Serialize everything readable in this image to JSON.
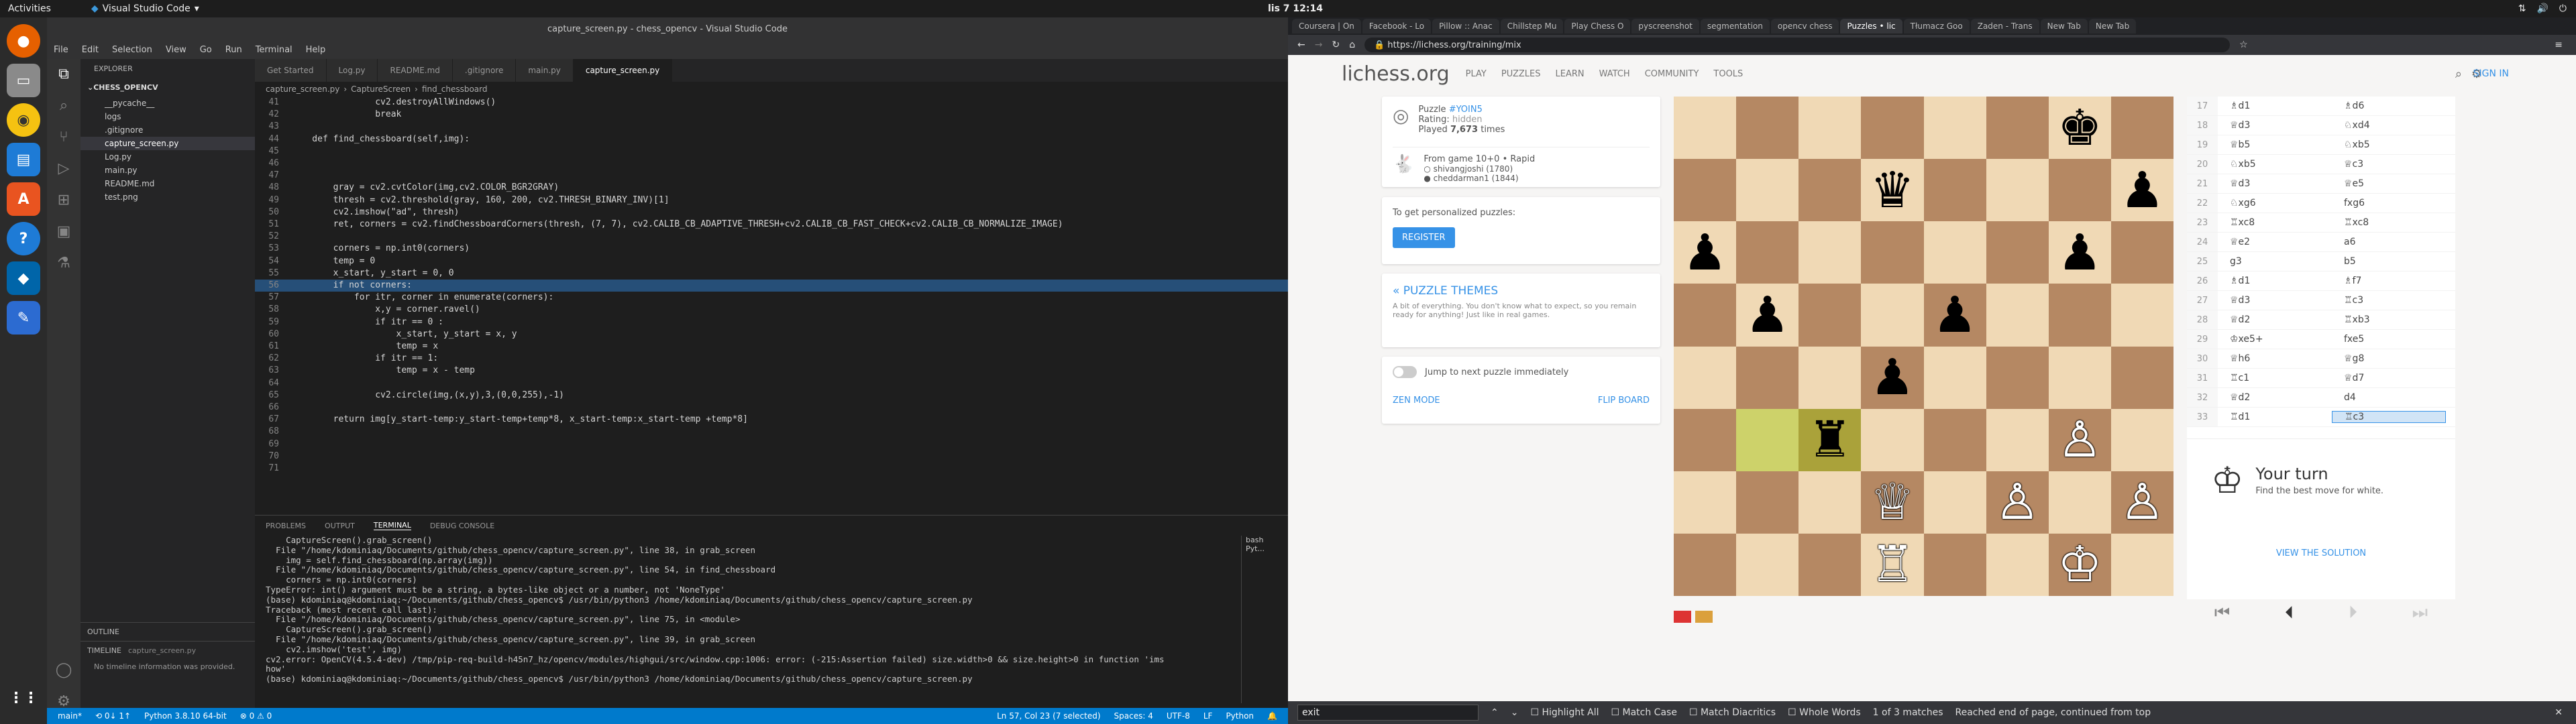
{
  "topbar": {
    "activities": "Activities",
    "app": "Visual Studio Code",
    "clock": "lis 7  12:14"
  },
  "vscode": {
    "title": "capture_screen.py - chess_opencv - Visual Studio Code",
    "menu": [
      "File",
      "Edit",
      "Selection",
      "View",
      "Go",
      "Run",
      "Terminal",
      "Help"
    ],
    "explorer": {
      "header": "EXPLORER",
      "project": "CHESS_OPENCV",
      "files": [
        "__pycache__",
        "logs",
        ".gitignore",
        "capture_screen.py",
        "Log.py",
        "main.py",
        "README.md",
        "test.png"
      ],
      "outline": "OUTLINE",
      "timeline": "TIMELINE",
      "timeline_file": "capture_screen.py",
      "timeline_msg": "No timeline information was provided."
    },
    "tabs": [
      "Get Started",
      "Log.py",
      "README.md",
      ".gitignore",
      "main.py",
      "capture_screen.py"
    ],
    "breadcrumb": [
      "capture_screen.py",
      "CaptureScreen",
      "find_chessboard"
    ],
    "code": [
      {
        "n": "41",
        "t": "                cv2.destroyAllWindows()"
      },
      {
        "n": "42",
        "t": "                break"
      },
      {
        "n": "43",
        "t": ""
      },
      {
        "n": "44",
        "t": "    def find_chessboard(self,img):"
      },
      {
        "n": "45",
        "t": ""
      },
      {
        "n": "46",
        "t": ""
      },
      {
        "n": "47",
        "t": ""
      },
      {
        "n": "48",
        "t": "        gray = cv2.cvtColor(img,cv2.COLOR_BGR2GRAY)"
      },
      {
        "n": "49",
        "t": "        thresh = cv2.threshold(gray, 160, 200, cv2.THRESH_BINARY_INV)[1]"
      },
      {
        "n": "50",
        "t": "        cv2.imshow(\"ad\", thresh)"
      },
      {
        "n": "51",
        "t": "        ret, corners = cv2.findChessboardCorners(thresh, (7, 7), cv2.CALIB_CB_ADAPTIVE_THRESH+cv2.CALIB_CB_FAST_CHECK+cv2.CALIB_CB_NORMALIZE_IMAGE)"
      },
      {
        "n": "52",
        "t": ""
      },
      {
        "n": "53",
        "t": "        corners = np.int0(corners)"
      },
      {
        "n": "54",
        "t": "        temp = 0"
      },
      {
        "n": "55",
        "t": "        x_start, y_start = 0, 0"
      },
      {
        "n": "56",
        "t": "        if not corners:"
      },
      {
        "n": "57",
        "t": "            for itr, corner in enumerate(corners):"
      },
      {
        "n": "58",
        "t": "                x,y = corner.ravel()"
      },
      {
        "n": "59",
        "t": "                if itr == 0 :"
      },
      {
        "n": "60",
        "t": "                    x_start, y_start = x, y"
      },
      {
        "n": "61",
        "t": "                    temp = x"
      },
      {
        "n": "62",
        "t": "                if itr == 1:"
      },
      {
        "n": "63",
        "t": "                    temp = x - temp"
      },
      {
        "n": "64",
        "t": ""
      },
      {
        "n": "65",
        "t": "                cv2.circle(img,(x,y),3,(0,0,255),-1)"
      },
      {
        "n": "66",
        "t": ""
      },
      {
        "n": "67",
        "t": "        return img[y_start-temp:y_start-temp+temp*8, x_start-temp:x_start-temp +temp*8]"
      },
      {
        "n": "68",
        "t": ""
      },
      {
        "n": "69",
        "t": ""
      },
      {
        "n": "70",
        "t": ""
      },
      {
        "n": "71",
        "t": ""
      }
    ],
    "panel_tabs": [
      "PROBLEMS",
      "OUTPUT",
      "TERMINAL",
      "DEBUG CONSOLE"
    ],
    "terminal": [
      "    CaptureScreen().grab_screen()",
      "  File \"/home/kdominiaq/Documents/github/chess_opencv/capture_screen.py\", line 38, in grab_screen",
      "    img = self.find_chessboard(np.array(img))",
      "  File \"/home/kdominiaq/Documents/github/chess_opencv/capture_screen.py\", line 54, in find_chessboard",
      "    corners = np.int0(corners)",
      "TypeError: int() argument must be a string, a bytes-like object or a number, not 'NoneType'",
      "(base) kdominiaq@kdominiaq:~/Documents/github/chess_opencv$ /usr/bin/python3 /home/kdominiaq/Documents/github/chess_opencv/capture_screen.py",
      "Traceback (most recent call last):",
      "  File \"/home/kdominiaq/Documents/github/chess_opencv/capture_screen.py\", line 75, in <module>",
      "    CaptureScreen().grab_screen()",
      "  File \"/home/kdominiaq/Documents/github/chess_opencv/capture_screen.py\", line 39, in grab_screen",
      "    cv2.imshow('test', img)",
      "cv2.error: OpenCV(4.5.4-dev) /tmp/pip-req-build-h45n7_hz/opencv/modules/highgui/src/window.cpp:1006: error: (-215:Assertion failed) size.width>0 && size.height>0 in function 'ims",
      "how'",
      "",
      "(base) kdominiaq@kdominiaq:~/Documents/github/chess_opencv$ /usr/bin/python3 /home/kdominiaq/Documents/github/chess_opencv/capture_screen.py"
    ],
    "terminal_side": [
      "bash",
      "Pyt..."
    ],
    "status": {
      "branch": "main*",
      "sync": "⟲ 0↓ 1↑",
      "python": "Python 3.8.10 64-bit",
      "problems": "⊗ 0 ⚠ 0",
      "position": "Ln 57, Col 23 (7 selected)",
      "spaces": "Spaces: 4",
      "encoding": "UTF-8",
      "eol": "LF",
      "lang": "Python"
    }
  },
  "browser": {
    "tabs": [
      "Coursera | On",
      "Facebook - Lo",
      "Pillow :: Anac",
      "Chillstep Mu",
      "Play Chess O",
      "pyscreenshot",
      "segmentation",
      "opencv chess",
      "Puzzles • lic",
      "Tłumacz Goo",
      "Zaden - Trans",
      "New Tab",
      "New Tab"
    ],
    "url": "https://lichess.org/training/mix",
    "find": {
      "value": "exit",
      "highlight_all": "Highlight All",
      "match_case": "Match Case",
      "diacritics": "Match Diacritics",
      "whole_words": "Whole Words",
      "matches": "1 of 3 matches",
      "reached": "Reached end of page, continued from top"
    }
  },
  "lichess": {
    "logo": "lichess.org",
    "nav": [
      "PLAY",
      "PUZZLES",
      "LEARN",
      "WATCH",
      "COMMUNITY",
      "TOOLS"
    ],
    "signin": "SIGN IN",
    "puzzle": {
      "label": "Puzzle",
      "id": "#YOIN5",
      "rating_label": "Rating:",
      "rating": "hidden",
      "played_label": "Played",
      "played_count": "7,673",
      "played_suffix": "times"
    },
    "game": {
      "from": "From game 10+0 • Rapid",
      "white": "shivangjoshi (1780)",
      "black": "cheddarman1 (1844)"
    },
    "personalized": "To get personalized puzzles:",
    "register": "REGISTER",
    "themes": {
      "title": "« PUZZLE THEMES",
      "desc": "A bit of everything. You don't know what to expect, so you remain ready for anything! Just like in real games."
    },
    "jump": "Jump to next puzzle immediately",
    "zen": "ZEN MODE",
    "flip": "FLIP BOARD",
    "turn": {
      "title": "Your turn",
      "desc": "Find the best move for white."
    },
    "view_solution": "VIEW THE SOLUTION",
    "board": [
      [
        "",
        "",
        "",
        "",
        "",
        "",
        "♚",
        ""
      ],
      [
        "",
        "",
        "",
        "♛",
        "",
        "",
        "",
        "♟"
      ],
      [
        "♟",
        "",
        "",
        "",
        "",
        "",
        "♟",
        ""
      ],
      [
        "",
        "♟",
        "",
        "",
        "♟",
        "",
        "",
        ""
      ],
      [
        "",
        "",
        "",
        "♟",
        "",
        "",
        "",
        ""
      ],
      [
        "",
        "",
        "♜",
        "",
        "",
        "",
        "♙",
        ""
      ],
      [
        "",
        "",
        "",
        "♕",
        "",
        "♙",
        "",
        "♙"
      ],
      [
        "",
        "",
        "",
        "♖",
        "",
        "",
        "♔",
        ""
      ]
    ],
    "moves": [
      [
        "17",
        "♗d1",
        "♗d6"
      ],
      [
        "18",
        "♕d3",
        "♘xd4"
      ],
      [
        "19",
        "♕b5",
        "♘xb5"
      ],
      [
        "20",
        "♘xb5",
        "♕c3"
      ],
      [
        "21",
        "♕d3",
        "♕e5"
      ],
      [
        "22",
        "♘xg6",
        "fxg6"
      ],
      [
        "23",
        "♖xc8",
        "♖xc8"
      ],
      [
        "24",
        "♕e2",
        "a6"
      ],
      [
        "25",
        "g3",
        "b5"
      ],
      [
        "26",
        "♗d1",
        "♗f7"
      ],
      [
        "27",
        "♕d3",
        "♖c3"
      ],
      [
        "28",
        "♕d2",
        "♖xb3"
      ],
      [
        "29",
        "♔xe5+",
        "fxe5"
      ],
      [
        "30",
        "♕h6",
        "♕g8"
      ],
      [
        "31",
        "♖c1",
        "♕d7"
      ],
      [
        "32",
        "♕d2",
        "d4"
      ],
      [
        "33",
        "♖d1",
        "♖c3"
      ]
    ]
  }
}
